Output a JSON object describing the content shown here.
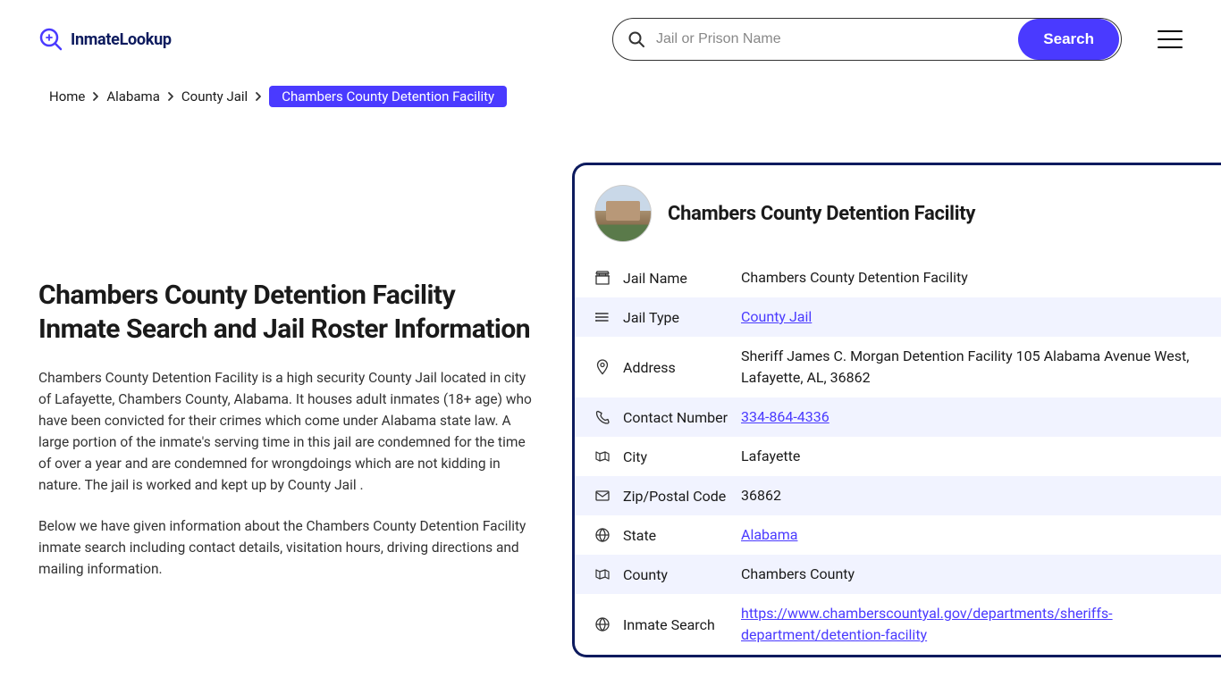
{
  "header": {
    "logo_text": "InmateLookup",
    "search_placeholder": "Jail or Prison Name",
    "search_button": "Search"
  },
  "breadcrumb": {
    "items": [
      "Home",
      "Alabama",
      "County Jail"
    ],
    "current": "Chambers County Detention Facility"
  },
  "content": {
    "title": "Chambers County Detention Facility Inmate Search and Jail Roster Information",
    "para1": "Chambers County Detention Facility is a high security County Jail located in city of Lafayette, Chambers County, Alabama. It houses adult inmates (18+ age) who have been convicted for their crimes which come under Alabama state law. A large portion of the inmate's serving time in this jail are condemned for the time of over a year and are condemned for wrongdoings which are not kidding in nature. The jail is worked and kept up by County Jail .",
    "para2": "Below we have given information about the Chambers County Detention Facility inmate search including contact details, visitation hours, driving directions and mailing information."
  },
  "card": {
    "title": "Chambers County Detention Facility",
    "rows": [
      {
        "label": "Jail Name",
        "value": "Chambers County Detention Facility",
        "link": false
      },
      {
        "label": "Jail Type",
        "value": "County Jail",
        "link": true
      },
      {
        "label": "Address",
        "value": "Sheriff James C. Morgan Detention Facility 105 Alabama Avenue West, Lafayette, AL, 36862",
        "link": false
      },
      {
        "label": "Contact Number",
        "value": "334-864-4336",
        "link": true
      },
      {
        "label": "City",
        "value": "Lafayette",
        "link": false
      },
      {
        "label": "Zip/Postal Code",
        "value": "36862",
        "link": false
      },
      {
        "label": "State",
        "value": "Alabama",
        "link": true
      },
      {
        "label": "County",
        "value": "Chambers County",
        "link": false
      },
      {
        "label": "Inmate Search",
        "value": "https://www.chamberscountyal.gov/departments/sheriffs-department/detention-facility",
        "link": true
      }
    ]
  }
}
